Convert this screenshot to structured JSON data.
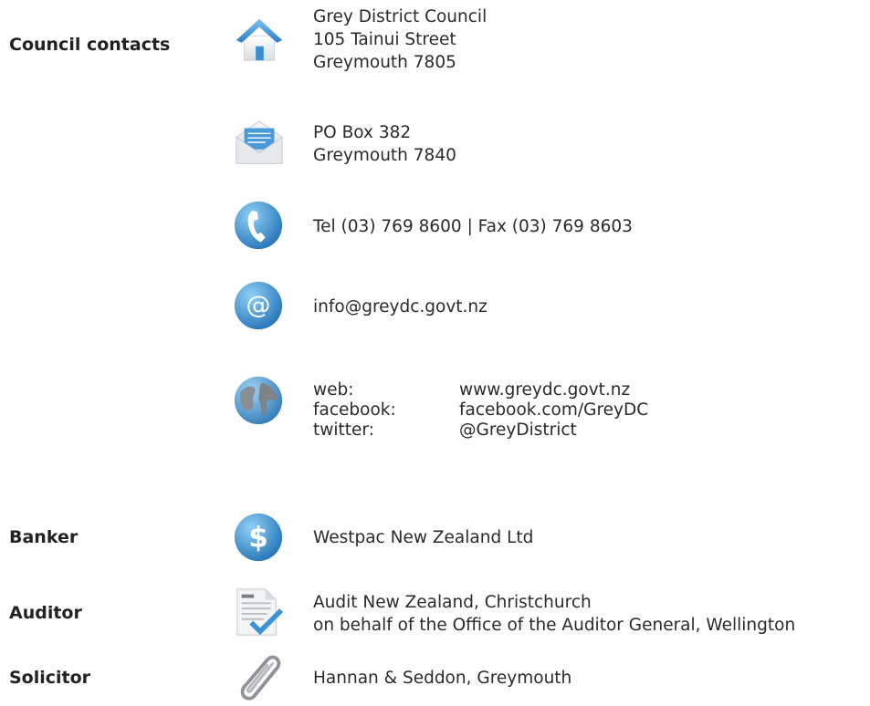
{
  "sections": {
    "council_contacts": "Council contacts",
    "banker": "Banker",
    "auditor": "Auditor",
    "solicitor": "Solicitor"
  },
  "address": {
    "line1": "Grey District Council",
    "line2": "105 Tainui Street",
    "line3": "Greymouth 7805",
    "icon": "house-icon"
  },
  "postal": {
    "line1": "PO Box 382",
    "line2": "Greymouth 7840",
    "icon": "envelope-icon"
  },
  "phone": {
    "text": "Tel (03) 769 8600 | Fax (03) 769 8603",
    "icon": "phone-icon"
  },
  "email": {
    "text": "info@greydc.govt.nz",
    "icon": "at-sign-icon"
  },
  "online": {
    "icon": "globe-icon",
    "rows": [
      {
        "label": "web:",
        "value": "www.greydc.govt.nz"
      },
      {
        "label": "facebook:",
        "value": "facebook.com/GreyDC"
      },
      {
        "label": "twitter:",
        "value": "@GreyDistrict"
      }
    ]
  },
  "banker": {
    "text": "Westpac New Zealand Ltd",
    "icon": "dollar-icon"
  },
  "auditor": {
    "line1": "Audit New Zealand, Christchurch",
    "line2": "on behalf of the Office of the Auditor General, Wellington",
    "icon": "document-check-icon"
  },
  "solicitor": {
    "text": "Hannan & Seddon, Greymouth",
    "icon": "paperclip-icon"
  },
  "colors": {
    "icon_blue": "#3f8fcf",
    "heading": "#222222",
    "text": "#2a2a2a"
  }
}
